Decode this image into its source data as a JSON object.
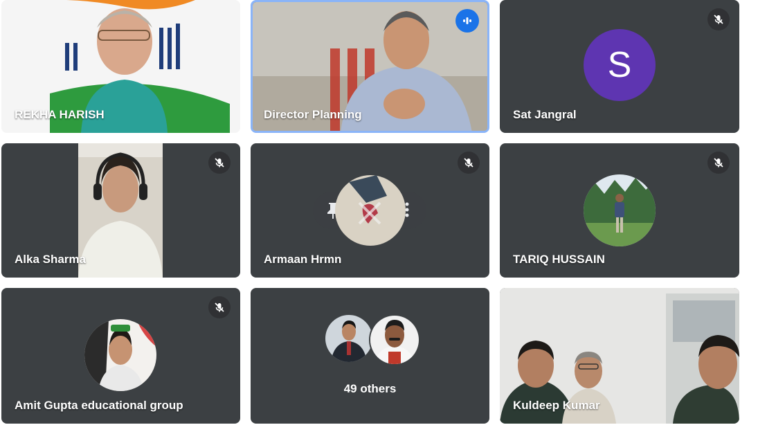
{
  "participants": [
    {
      "name": "REKHA HARISH"
    },
    {
      "name": "Director Planning"
    },
    {
      "name": "Sat Jangral",
      "initial": "S"
    },
    {
      "name": "Alka Sharma"
    },
    {
      "name": "Armaan Hrmn"
    },
    {
      "name": "TARIQ HUSSAIN"
    },
    {
      "name": "Amit Gupta educational group"
    },
    {
      "name": "Kuldeep Kumar"
    }
  ],
  "others": {
    "label": "49 others"
  },
  "icons": {
    "mic_off": "mic-off-icon",
    "speaking": "audio-wave-icon",
    "pin": "pin-icon",
    "more": "more-vert-icon"
  },
  "colors": {
    "tile_bg": "#3c4043",
    "speaking_border": "#8ab4f8",
    "avatar_s": "#5e35b1",
    "speaking_badge": "#1a73e8"
  }
}
